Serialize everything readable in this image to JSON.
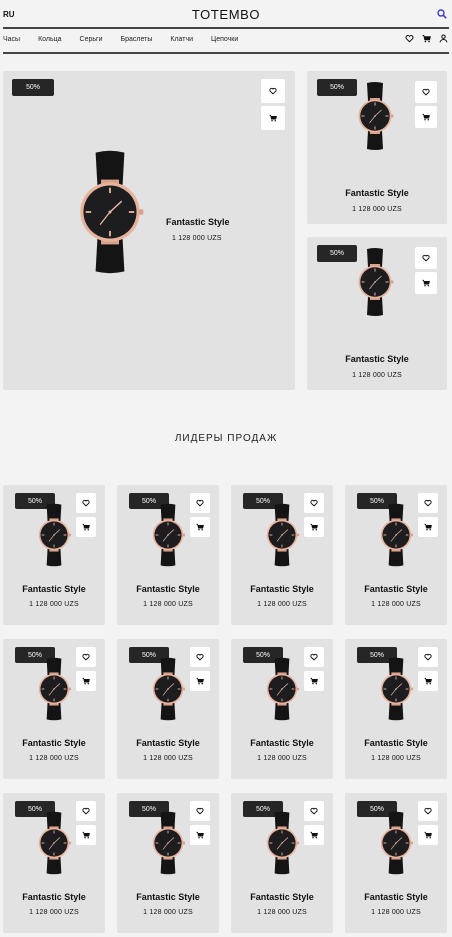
{
  "header": {
    "lang": "RU",
    "logo": "TOTEMBO",
    "nav": [
      "Часы",
      "Кольца",
      "Серьги",
      "Браслеты",
      "Клатчи",
      "Цепочки"
    ],
    "icons": [
      "search-icon",
      "heart-icon",
      "cart-icon",
      "user-icon"
    ]
  },
  "hero": [
    {
      "badge": "50%",
      "name": "Fantastic Style",
      "price": "1 128 000 UZS"
    },
    {
      "badge": "50%",
      "name": "Fantastic Style",
      "price": "1 128 000 UZS"
    },
    {
      "badge": "50%",
      "name": "Fantastic Style",
      "price": "1 128 000 UZS"
    }
  ],
  "bestsellers": {
    "title": "ЛИДЕРЫ ПРОДАЖ",
    "products": [
      {
        "badge": "50%",
        "name": "Fantastic Style",
        "price": "1 128 000 UZS"
      },
      {
        "badge": "50%",
        "name": "Fantastic Style",
        "price": "1 128 000 UZS"
      },
      {
        "badge": "50%",
        "name": "Fantastic Style",
        "price": "1 128 000 UZS"
      },
      {
        "badge": "50%",
        "name": "Fantastic Style",
        "price": "1 128 000 UZS"
      },
      {
        "badge": "50%",
        "name": "Fantastic Style",
        "price": "1 128 000 UZS"
      },
      {
        "badge": "50%",
        "name": "Fantastic Style",
        "price": "1 128 000 UZS"
      },
      {
        "badge": "50%",
        "name": "Fantastic Style",
        "price": "1 128 000 UZS"
      },
      {
        "badge": "50%",
        "name": "Fantastic Style",
        "price": "1 128 000 UZS"
      },
      {
        "badge": "50%",
        "name": "Fantastic Style",
        "price": "1 128 000 UZS"
      },
      {
        "badge": "50%",
        "name": "Fantastic Style",
        "price": "1 128 000 UZS"
      },
      {
        "badge": "50%",
        "name": "Fantastic Style",
        "price": "1 128 000 UZS"
      },
      {
        "badge": "50%",
        "name": "Fantastic Style",
        "price": "1 128 000 UZS"
      }
    ]
  },
  "colors": {
    "accent_search": "#3a3ad6",
    "badge_bg": "#262626",
    "card_bg": "#e2e2e2"
  }
}
